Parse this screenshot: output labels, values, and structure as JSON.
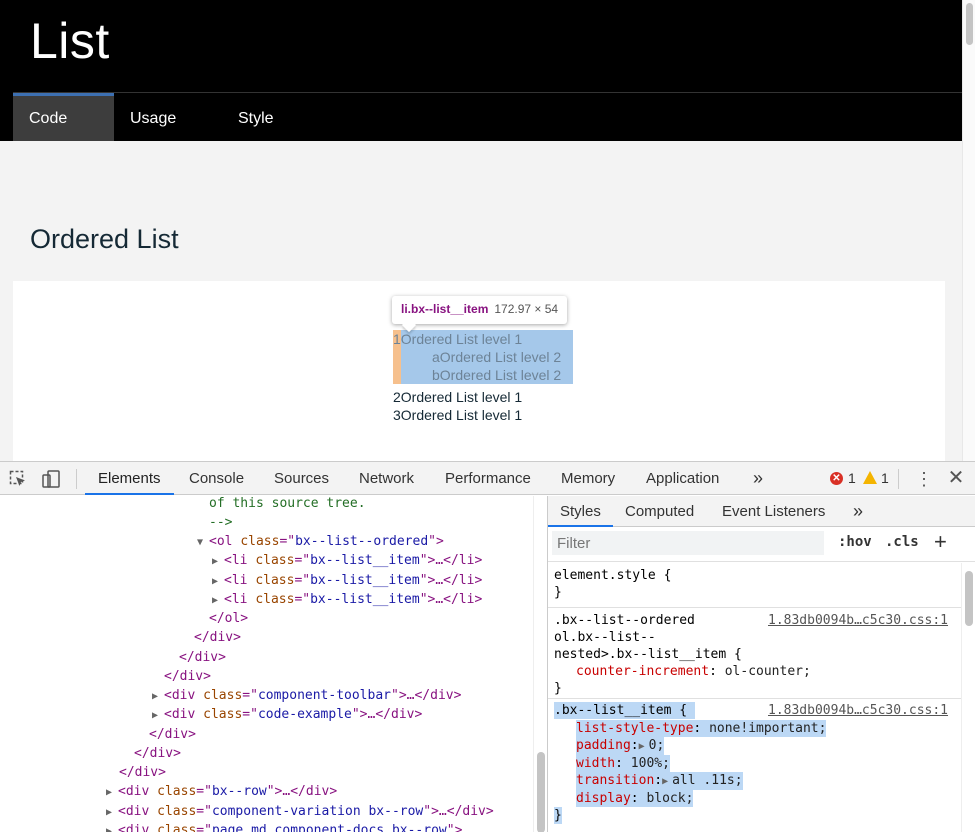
{
  "site": {
    "title": "List",
    "tabs": [
      {
        "label": "Code",
        "active": true
      },
      {
        "label": "Usage",
        "active": false
      },
      {
        "label": "Style",
        "active": false
      }
    ],
    "section_title": "Ordered List",
    "example": {
      "tooltip_selector": "li.bx--list__item",
      "tooltip_size": "172.97 × 54",
      "items": [
        {
          "marker": "1",
          "text": "Ordered List level 1"
        },
        {
          "marker": "a",
          "text": "Ordered List level 2"
        },
        {
          "marker": "b",
          "text": "Ordered List level 2"
        },
        {
          "marker": "2",
          "text": "Ordered List level 1"
        },
        {
          "marker": "3",
          "text": "Ordered List level 1"
        }
      ]
    }
  },
  "devtools": {
    "tabs": {
      "elements": "Elements",
      "console": "Console",
      "sources": "Sources",
      "network": "Network",
      "performance": "Performance",
      "memory": "Memory",
      "application": "Application",
      "more": "»"
    },
    "errors": "1",
    "warnings": "1",
    "dom": {
      "comment_line": "of this source tree.",
      "comment_end": "-->",
      "ol_tag": "<ol",
      "ol_class": "bx--list--ordered",
      "li_class": "bx--list__item",
      "ol_close": "</ol>",
      "div_close": "</div>",
      "toolbar_class": "component-toolbar",
      "code_example_class": "code-example",
      "row_class": "bx--row",
      "variation_class": "component-variation bx--row",
      "docs_class": "page md component-docs bx--row"
    },
    "styles": {
      "tabs": {
        "styles": "Styles",
        "computed": "Computed",
        "events": "Event Listeners",
        "more": "»"
      },
      "filter_placeholder": "Filter",
      "hov": ":hov",
      "cls": ".cls",
      "add": "+",
      "element_style": "element.style {",
      "close_brace": "}",
      "rule1_selector_1": ".bx--list--ordered",
      "rule1_selector_2": "ol.bx--list--",
      "rule1_selector_3": "nested>.bx--list__item {",
      "rule1_source": "1.83db0094b…c5c30.css:1",
      "rule1_prop": "counter-increment",
      "rule1_val": "ol-counter;",
      "rule2_selector": ".bx--list__item {",
      "rule2_source": "1.83db0094b…c5c30.css:1",
      "rule2_props": [
        {
          "name": "list-style-type",
          "value": "none!important;"
        },
        {
          "name": "padding",
          "value": "0;"
        },
        {
          "name": "width",
          "value": "100%;"
        },
        {
          "name": "transition",
          "value": "all .11s;"
        },
        {
          "name": "display",
          "value": "block;"
        }
      ]
    }
  }
}
